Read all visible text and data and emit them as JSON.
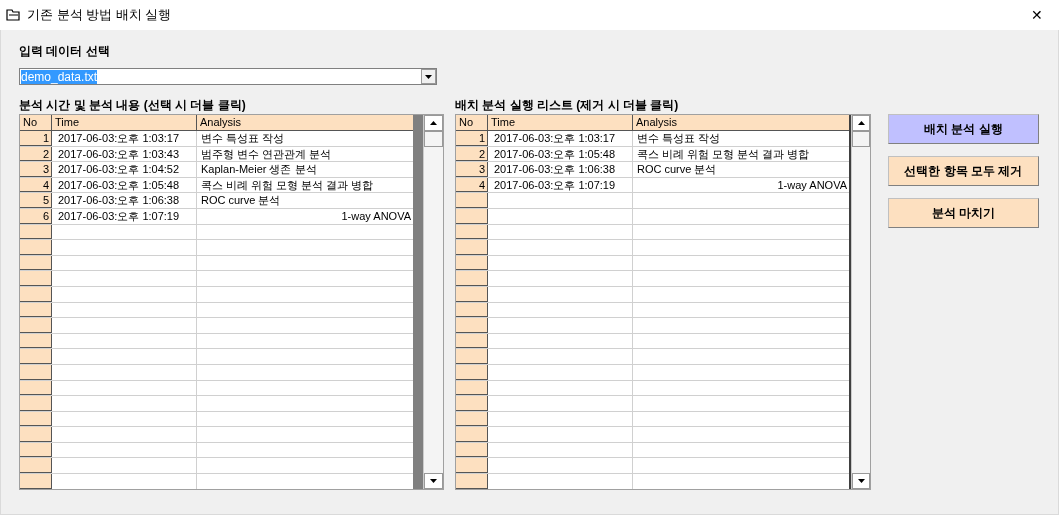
{
  "window": {
    "title": "기존 분석 방법 배치 실행",
    "close": "✕"
  },
  "input": {
    "label": "입력 데이터 선택",
    "value": "demo_data.txt"
  },
  "left_grid": {
    "title": "분석 시간 및 분석 내용 (선택 시 더블 클릭)",
    "columns": [
      "No",
      "Time",
      "Analysis"
    ],
    "rows": [
      {
        "no": "1",
        "time": "2017-06-03:오후 1:03:17",
        "analysis": "변수 특성표 작성",
        "kind": "text"
      },
      {
        "no": "2",
        "time": "2017-06-03:오후 1:03:43",
        "analysis": "범주형 변수 연관관계 분석",
        "kind": "text"
      },
      {
        "no": "3",
        "time": "2017-06-03:오후 1:04:52",
        "analysis": "Kaplan-Meier 생존 분석",
        "kind": "text"
      },
      {
        "no": "4",
        "time": "2017-06-03:오후 1:05:48",
        "analysis": "콕스 비례 위험 모형 분석 결과 병합",
        "kind": "text"
      },
      {
        "no": "5",
        "time": "2017-06-03:오후 1:06:38",
        "analysis": "ROC curve 분석",
        "kind": "text"
      },
      {
        "no": "6",
        "time": "2017-06-03:오후 1:07:19",
        "analysis": "1-way ANOVA",
        "kind": "numeric"
      }
    ]
  },
  "right_grid": {
    "title": "배치 분석 실행 리스트 (제거 시 더블 클릭)",
    "columns": [
      "No",
      "Time",
      "Analysis"
    ],
    "rows": [
      {
        "no": "1",
        "time": "2017-06-03:오후 1:03:17",
        "analysis": "변수 특성표 작성",
        "kind": "text"
      },
      {
        "no": "2",
        "time": "2017-06-03:오후 1:05:48",
        "analysis": "콕스 비례 위험 모형 분석 결과 병합",
        "kind": "text"
      },
      {
        "no": "3",
        "time": "2017-06-03:오후 1:06:38",
        "analysis": "ROC curve 분석",
        "kind": "text"
      },
      {
        "no": "4",
        "time": "2017-06-03:오후 1:07:19",
        "analysis": "1-way ANOVA",
        "kind": "numeric"
      }
    ]
  },
  "buttons": [
    {
      "label": "배치 분석 실행",
      "selected": true
    },
    {
      "label": "선택한 항목 모두 제거",
      "selected": false
    },
    {
      "label": "분석 마치기",
      "selected": false
    }
  ]
}
